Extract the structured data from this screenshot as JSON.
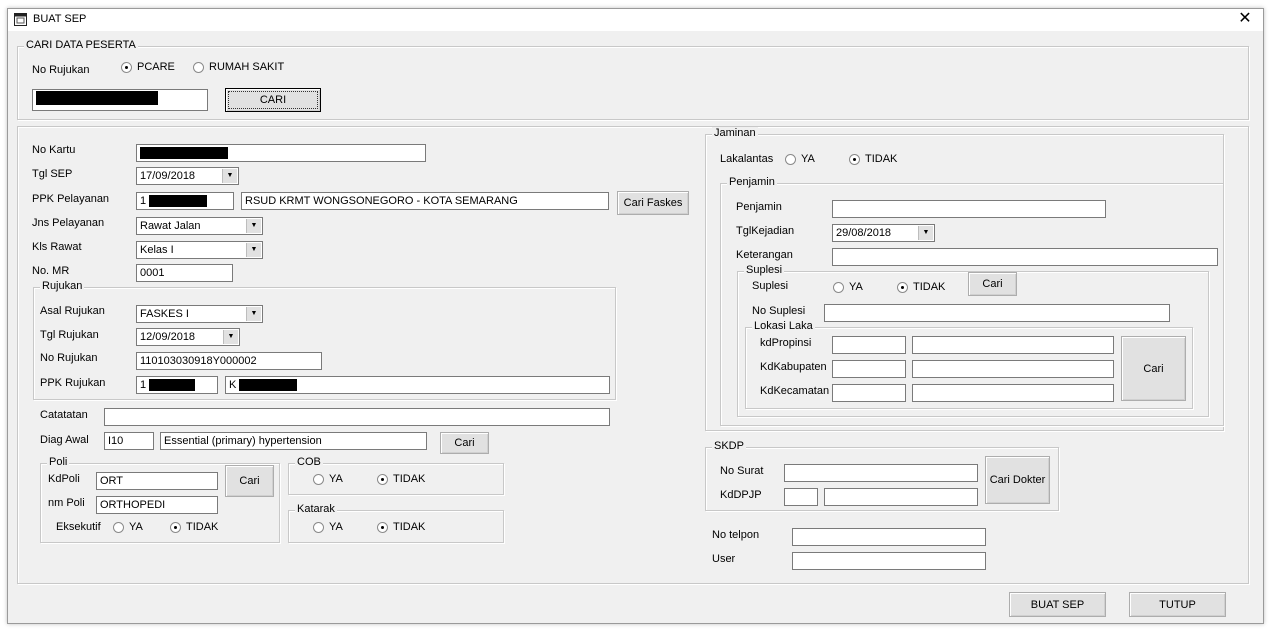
{
  "window": {
    "title": "BUAT SEP",
    "close_glyph": "✕"
  },
  "cari_peserta": {
    "legend": "CARI DATA PESERTA",
    "no_rujukan_label": "No Rujukan",
    "radio_pcare": "PCARE",
    "radio_rs": "RUMAH SAKIT",
    "cari_button": "CARI"
  },
  "form": {
    "no_kartu_label": "No Kartu",
    "tgl_sep_label": "Tgl SEP",
    "tgl_sep_value": "17/09/2018",
    "ppk_pelayanan_label": "PPK Pelayanan",
    "ppk_pelayanan_code_prefix": "1",
    "ppk_pelayanan_name": "RSUD KRMT WONGSONEGORO - KOTA SEMARANG",
    "cari_faskes_button": "Cari Faskes",
    "jns_pelayanan_label": "Jns Pelayanan",
    "jns_pelayanan_value": "Rawat Jalan",
    "kls_rawat_label": "Kls Rawat",
    "kls_rawat_value": "Kelas I",
    "no_mr_label": "No. MR",
    "no_mr_value": "0001"
  },
  "rujukan": {
    "legend": "Rujukan",
    "asal_label": "Asal Rujukan",
    "asal_value": "FASKES I",
    "tgl_label": "Tgl Rujukan",
    "tgl_value": "12/09/2018",
    "no_label": "No Rujukan",
    "no_value": "110103030918Y000002",
    "ppk_label": "PPK Rujukan",
    "ppk_code_prefix": "1",
    "ppk_name_prefix": "K"
  },
  "catatan": {
    "label": "Catatatan"
  },
  "diagnosa": {
    "label": "Diag Awal",
    "code": "I10",
    "name": "Essential (primary) hypertension",
    "cari_button": "Cari"
  },
  "poli": {
    "legend": "Poli",
    "kd_label": "KdPoli",
    "kd_value": "ORT",
    "nm_label": "nm Poli",
    "nm_value": "ORTHOPEDI",
    "cari_button": "Cari",
    "eksekutif_label": "Eksekutif",
    "ya": "YA",
    "tidak": "TIDAK"
  },
  "cob": {
    "legend": "COB",
    "ya": "YA",
    "tidak": "TIDAK"
  },
  "katarak": {
    "legend": "Katarak",
    "ya": "YA",
    "tidak": "TIDAK"
  },
  "jaminan": {
    "legend": "Jaminan",
    "lakalantas_label": "Lakalantas",
    "ya": "YA",
    "tidak": "TIDAK",
    "penjamin_legend": "Penjamin",
    "penjamin_label": "Penjamin",
    "tgl_kejadian_label": "TglKejadian",
    "tgl_kejadian_value": "29/08/2018",
    "keterangan_label": "Keterangan",
    "suplesi_legend": "Suplesi",
    "suplesi_label": "Suplesi",
    "suplesi_cari": "Cari",
    "no_suplesi_label": "No Suplesi",
    "lokasi_legend": "Lokasi Laka",
    "kd_propinsi_label": "kdPropinsi",
    "kd_kabupaten_label": "KdKabupaten",
    "kd_kecamatan_label": "KdKecamatan",
    "lokasi_cari": "Cari"
  },
  "skdp": {
    "legend": "SKDP",
    "no_surat_label": "No Surat",
    "kd_dpjp_label": "KdDPJP",
    "cari_dokter_button": "Cari Dokter"
  },
  "contact": {
    "no_telpon_label": "No telpon",
    "user_label": "User"
  },
  "footer": {
    "buat_sep_button": "BUAT SEP",
    "tutup_button": "TUTUP"
  }
}
